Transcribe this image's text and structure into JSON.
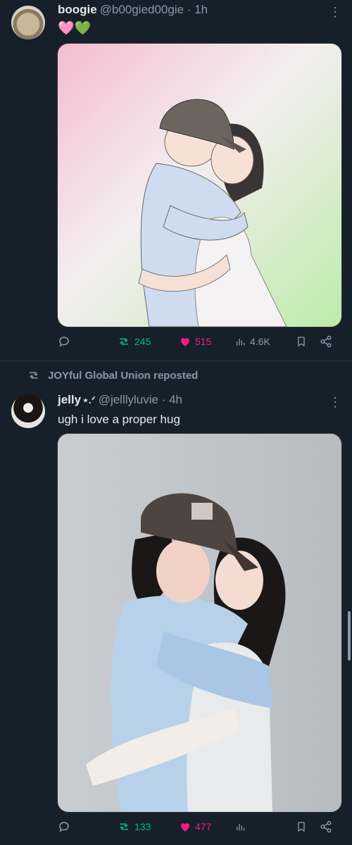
{
  "post1": {
    "author_name": "boogie",
    "author_handle": "@b00gied00gie",
    "time": "· 1h",
    "body": "🩷💚",
    "stats": {
      "retweets": "245",
      "likes": "515",
      "views": "4.6K"
    }
  },
  "repost_line": "JOYful Global Union reposted",
  "post2": {
    "author_name": "jelly",
    "name_suffix": "⋆.ᐟ",
    "author_handle": "@jelllyluvie",
    "time": "· 4h",
    "body": "ugh i love a proper hug",
    "stats": {
      "retweets": "133",
      "likes": "477"
    }
  },
  "icons": {
    "reply": "reply-icon",
    "retweet": "retweet-icon",
    "like": "heart-icon",
    "views": "views-icon",
    "bookmark": "bookmark-icon",
    "share": "share-icon",
    "more": "more-icon"
  },
  "colors": {
    "bg": "#15202b",
    "muted": "#8b98a5",
    "retweet": "#00ba7c",
    "like": "#f91880"
  }
}
